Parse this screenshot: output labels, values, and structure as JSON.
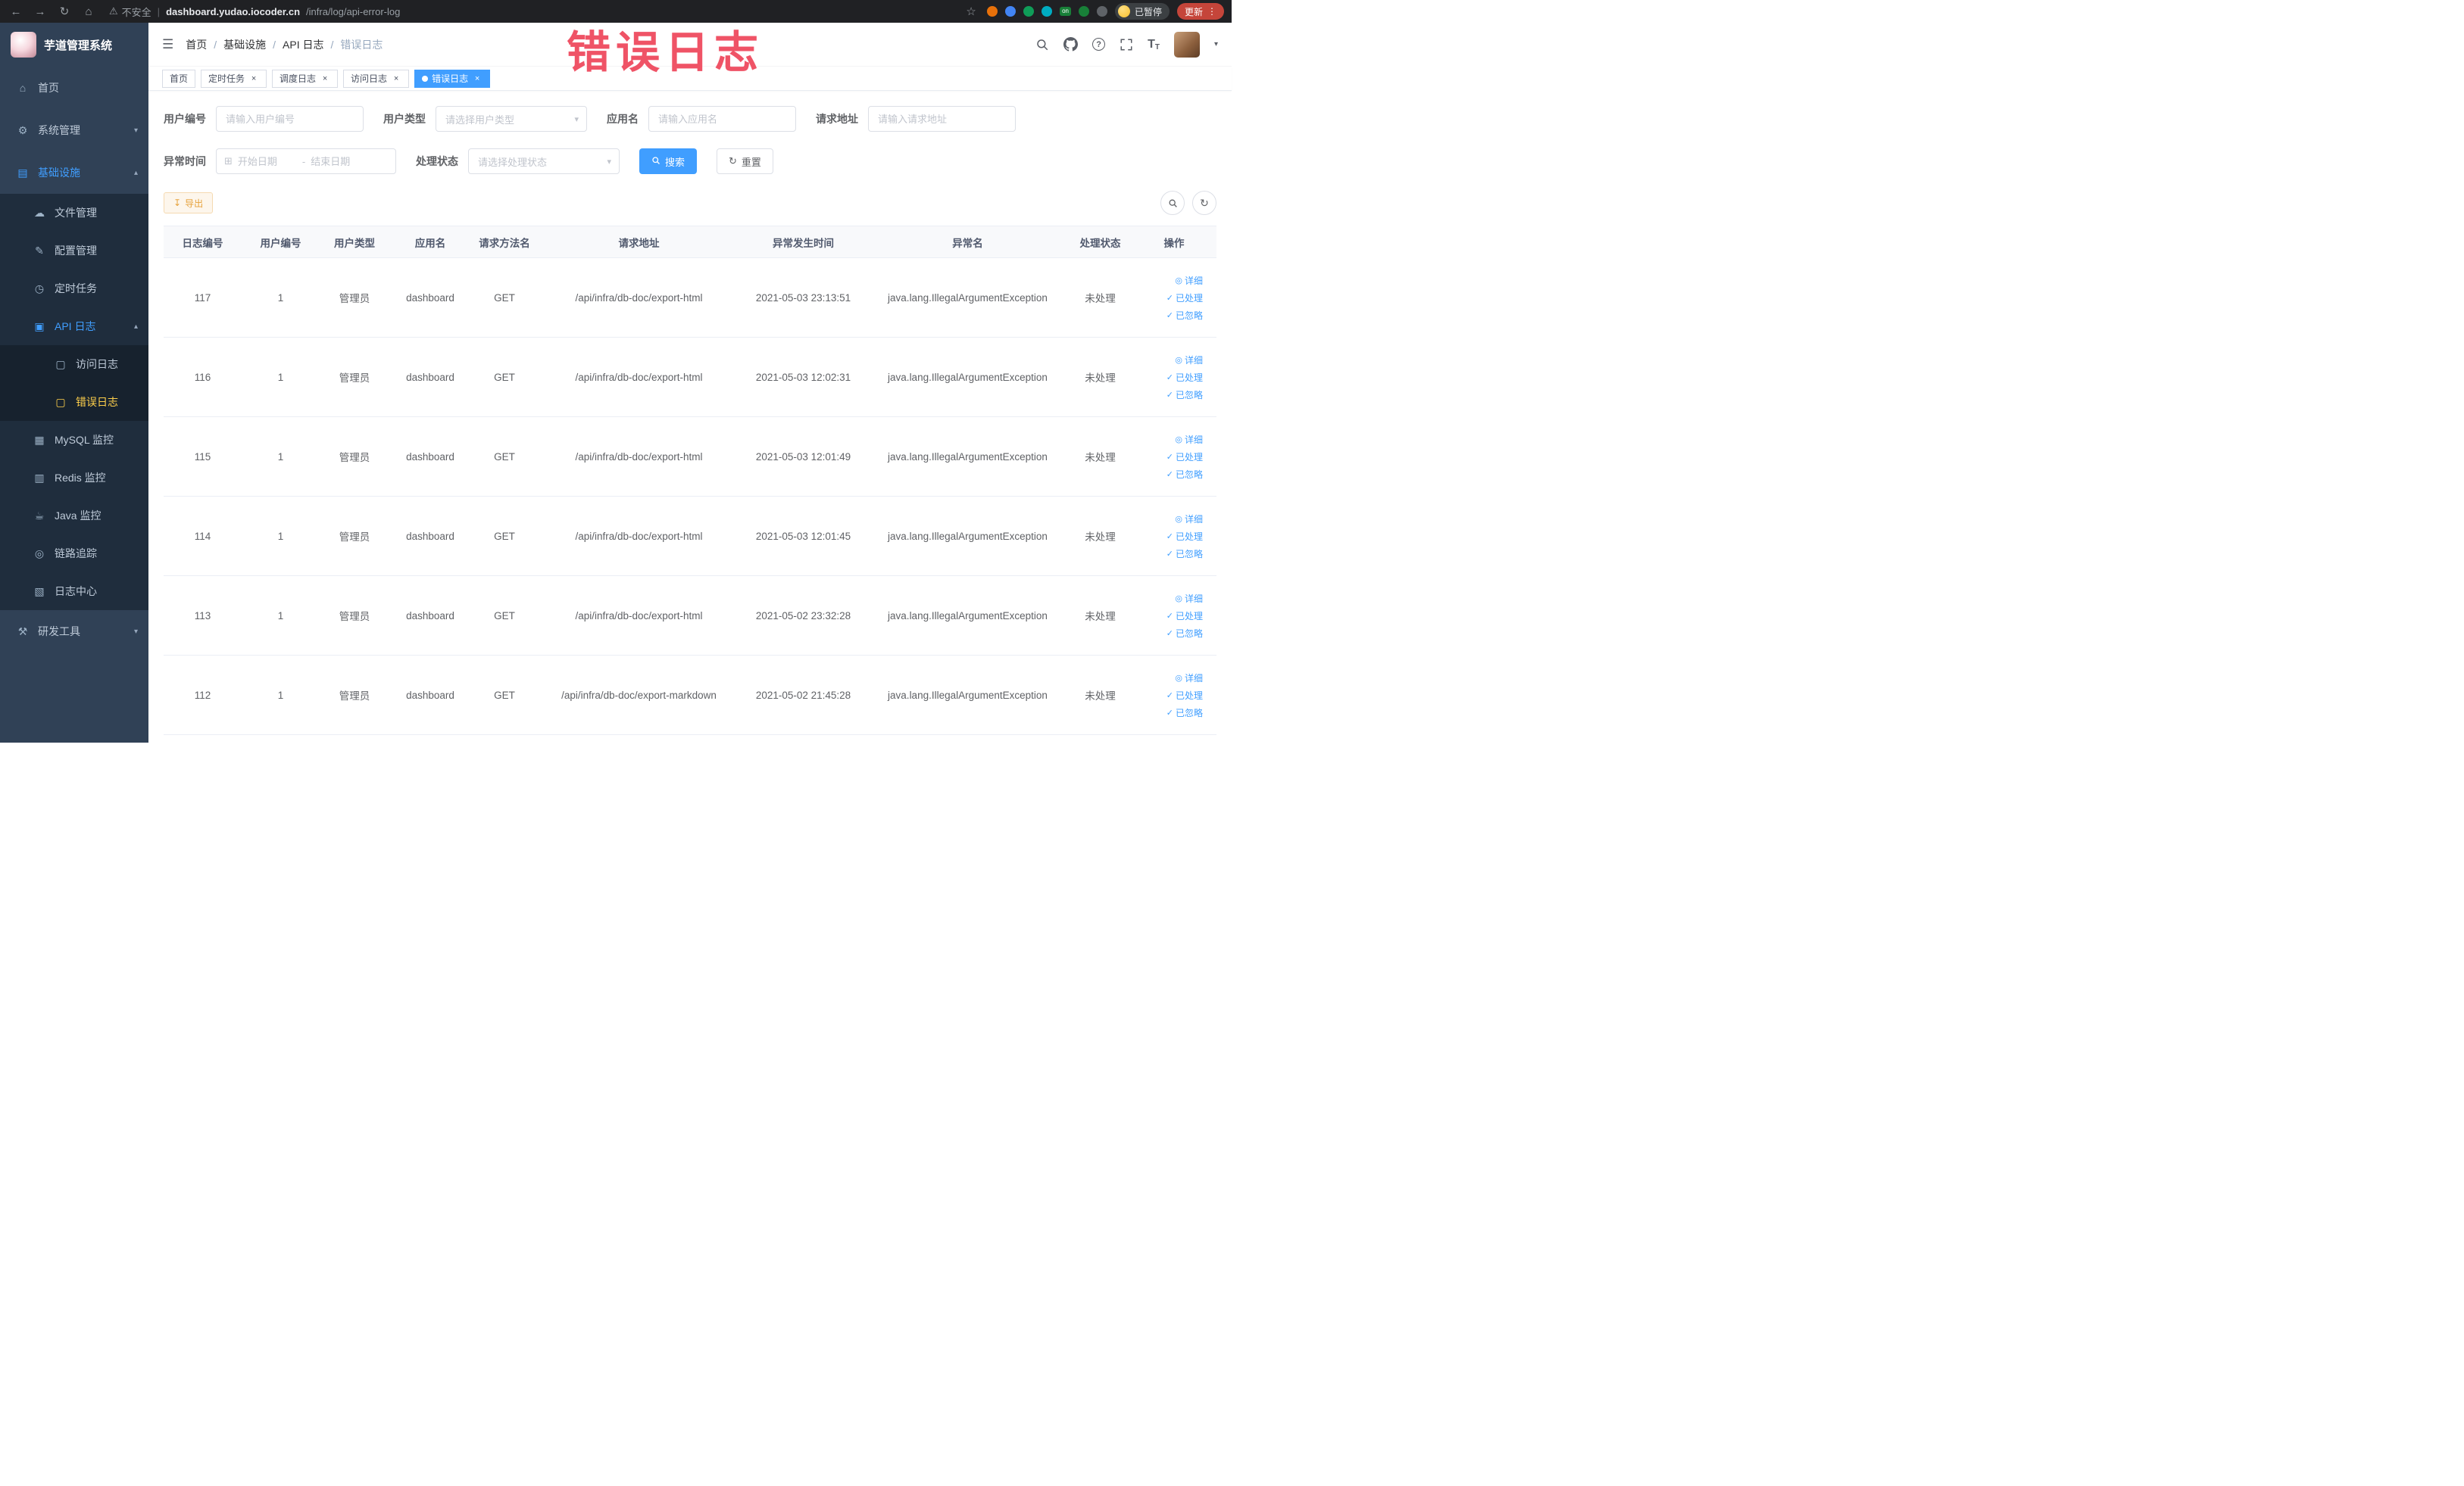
{
  "colors": {
    "accent": "#409eff",
    "sidebar_bg": "#304156",
    "menu_active_text": "#ffd04b",
    "warning": "#e6a23c",
    "tag_active_bg": "#409eff",
    "watermark": "#ef5366"
  },
  "watermark_text": "错误日志",
  "browser": {
    "security_label": "不安全",
    "url_host": "dashboard.yudao.iocoder.cn",
    "url_path": "/infra/log/api-error-log",
    "extensions_on_badge": "on",
    "profile_badge": "已暂停",
    "update_button": "更新"
  },
  "icons": {
    "back": "←",
    "forward": "→",
    "reload": "↻",
    "home_nav": "⌂",
    "warning": "⚠",
    "star": "☆",
    "kebab": "⋮",
    "hamburger": "☰",
    "question": "?",
    "caret_down": "▾",
    "chevron_down": "▾",
    "close": "×",
    "calendar": "⊞",
    "refresh": "↻",
    "download": "↧",
    "font_size_big": "T",
    "font_size_small": "T"
  },
  "sidebar": {
    "logo_title": "芋道管理系统",
    "items": [
      {
        "label": "首页",
        "icon": "⌂"
      },
      {
        "label": "系统管理",
        "icon": "⚙",
        "arrow": "▾"
      },
      {
        "label": "基础设施",
        "icon": "▤",
        "arrow": "▴"
      },
      {
        "label": "文件管理",
        "icon": "☁"
      },
      {
        "label": "配置管理",
        "icon": "✎"
      },
      {
        "label": "定时任务",
        "icon": "◷"
      },
      {
        "label": "API 日志",
        "icon": "▣",
        "arrow": "▴"
      },
      {
        "label": "访问日志",
        "icon": "▢"
      },
      {
        "label": "错误日志",
        "icon": "▢"
      },
      {
        "label": "MySQL 监控",
        "icon": "▦"
      },
      {
        "label": "Redis 监控",
        "icon": "▥"
      },
      {
        "label": "Java 监控",
        "icon": "☕"
      },
      {
        "label": "链路追踪",
        "icon": "◎"
      },
      {
        "label": "日志中心",
        "icon": "▧"
      },
      {
        "label": "研发工具",
        "icon": "⚒",
        "arrow": "▾"
      }
    ]
  },
  "breadcrumb": {
    "separator": "/",
    "items": [
      "首页",
      "基础设施",
      "API 日志",
      "错误日志"
    ]
  },
  "tags": [
    {
      "label": "首页"
    },
    {
      "label": "定时任务"
    },
    {
      "label": "调度日志"
    },
    {
      "label": "访问日志"
    },
    {
      "label": "错误日志"
    }
  ],
  "filters": {
    "user_id_label": "用户编号",
    "user_id_placeholder": "请输入用户编号",
    "user_type_label": "用户类型",
    "user_type_placeholder": "请选择用户类型",
    "app_name_label": "应用名",
    "app_name_placeholder": "请输入应用名",
    "request_url_label": "请求地址",
    "request_url_placeholder": "请输入请求地址",
    "time_label": "异常时间",
    "time_start_placeholder": "开始日期",
    "time_separator": "-",
    "time_end_placeholder": "结束日期",
    "status_label": "处理状态",
    "status_placeholder": "请选择处理状态",
    "search_button": "搜索",
    "reset_button": "重置"
  },
  "toolbar": {
    "export_button": "导出"
  },
  "table": {
    "columns": [
      "日志编号",
      "用户编号",
      "用户类型",
      "应用名",
      "请求方法名",
      "请求地址",
      "异常发生时间",
      "异常名",
      "处理状态",
      "操作"
    ],
    "actions": [
      {
        "label": "详细",
        "icon": "◎"
      },
      {
        "label": "已处理",
        "icon": "✓"
      },
      {
        "label": "已忽略",
        "icon": "✓"
      }
    ],
    "rows": [
      {
        "id": "117",
        "user_id": "1",
        "user_type": "管理员",
        "app": "dashboard",
        "method": "GET",
        "url": "/api/infra/db-doc/export-html",
        "time": "2021-05-03 23:13:51",
        "exception": "java.lang.IllegalArgumentException",
        "status": "未处理"
      },
      {
        "id": "116",
        "user_id": "1",
        "user_type": "管理员",
        "app": "dashboard",
        "method": "GET",
        "url": "/api/infra/db-doc/export-html",
        "time": "2021-05-03 12:02:31",
        "exception": "java.lang.IllegalArgumentException",
        "status": "未处理"
      },
      {
        "id": "115",
        "user_id": "1",
        "user_type": "管理员",
        "app": "dashboard",
        "method": "GET",
        "url": "/api/infra/db-doc/export-html",
        "time": "2021-05-03 12:01:49",
        "exception": "java.lang.IllegalArgumentException",
        "status": "未处理"
      },
      {
        "id": "114",
        "user_id": "1",
        "user_type": "管理员",
        "app": "dashboard",
        "method": "GET",
        "url": "/api/infra/db-doc/export-html",
        "time": "2021-05-03 12:01:45",
        "exception": "java.lang.IllegalArgumentException",
        "status": "未处理"
      },
      {
        "id": "113",
        "user_id": "1",
        "user_type": "管理员",
        "app": "dashboard",
        "method": "GET",
        "url": "/api/infra/db-doc/export-html",
        "time": "2021-05-02 23:32:28",
        "exception": "java.lang.IllegalArgumentException",
        "status": "未处理"
      },
      {
        "id": "112",
        "user_id": "1",
        "user_type": "管理员",
        "app": "dashboard",
        "method": "GET",
        "url": "/api/infra/db-doc/export-markdown",
        "time": "2021-05-02 21:45:28",
        "exception": "java.lang.IllegalArgumentException",
        "status": "未处理"
      }
    ]
  }
}
